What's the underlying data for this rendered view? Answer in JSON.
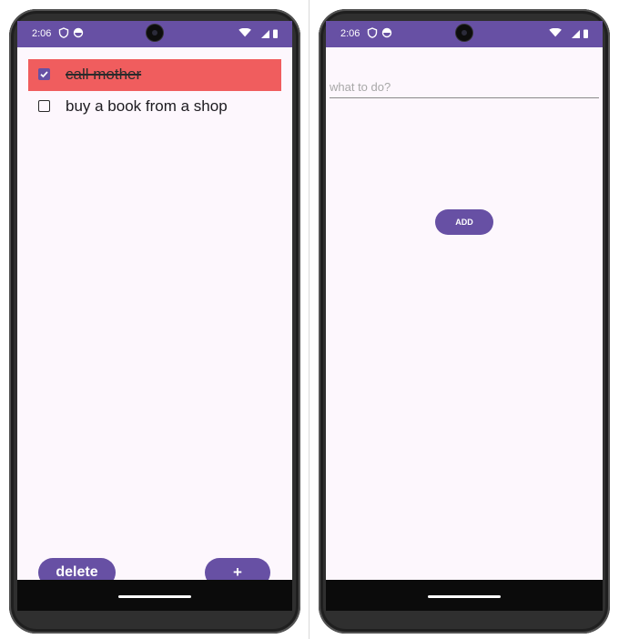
{
  "status_bar": {
    "time": "2:06"
  },
  "list_screen": {
    "items": [
      {
        "label": "call mother",
        "checked": true
      },
      {
        "label": "buy a book from a shop",
        "checked": false
      }
    ],
    "delete_label": "delete",
    "add_label": "+"
  },
  "add_screen": {
    "input_placeholder": "what to do?",
    "input_value": "",
    "add_button_label": "ADD"
  },
  "colors": {
    "primary": "#6750a4",
    "checked_row": "#f05d5e",
    "background": "#fdf7fd"
  }
}
